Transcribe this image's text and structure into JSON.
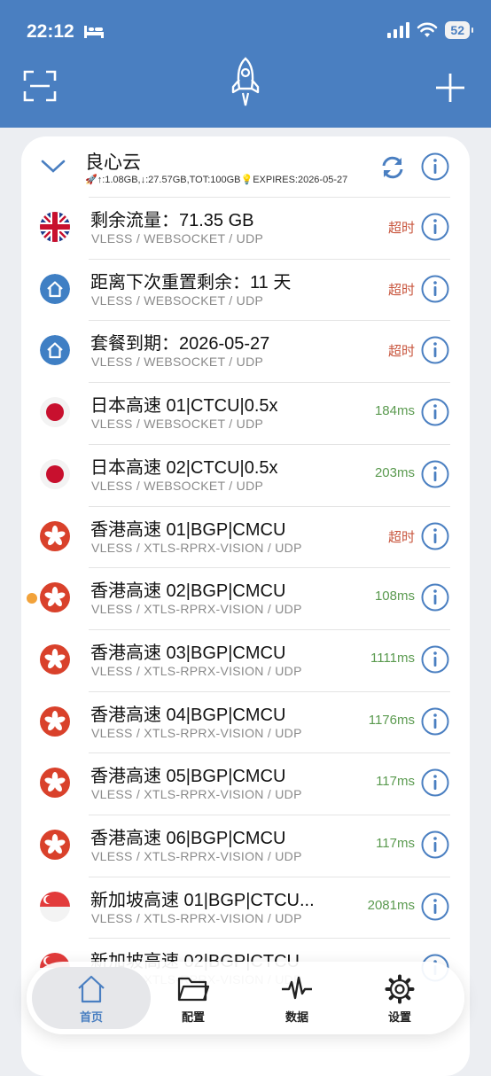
{
  "status": {
    "time": "22:12",
    "battery": "52"
  },
  "colors": {
    "header": "#4a7fc1",
    "latency_ok": "#5a9a4f",
    "latency_timeout": "#c8553d",
    "selected_dot": "#f2a23a"
  },
  "group": {
    "name": "良心云",
    "info": "🚀↑:1.08GB,↓:27.57GB,TOT:100GB💡EXPIRES:2026-05-27"
  },
  "servers": [
    {
      "flag": "uk",
      "name": "剩余流量：71.35 GB",
      "protocol": "VLESS / WEBSOCKET / UDP",
      "latency": "超时",
      "timeout": true
    },
    {
      "flag": "home",
      "name": "距离下次重置剩余：11 天",
      "protocol": "VLESS / WEBSOCKET / UDP",
      "latency": "超时",
      "timeout": true
    },
    {
      "flag": "home",
      "name": "套餐到期：2026-05-27",
      "protocol": "VLESS / WEBSOCKET / UDP",
      "latency": "超时",
      "timeout": true
    },
    {
      "flag": "jp",
      "name": "日本高速 01|CTCU|0.5x",
      "protocol": "VLESS / WEBSOCKET / UDP",
      "latency": "184ms",
      "timeout": false
    },
    {
      "flag": "jp",
      "name": "日本高速 02|CTCU|0.5x",
      "protocol": "VLESS / WEBSOCKET / UDP",
      "latency": "203ms",
      "timeout": false
    },
    {
      "flag": "hk",
      "name": "香港高速 01|BGP|CMCU",
      "protocol": "VLESS / XTLS-RPRX-VISION / UDP",
      "latency": "超时",
      "timeout": true
    },
    {
      "flag": "hk",
      "name": "香港高速 02|BGP|CMCU",
      "protocol": "VLESS / XTLS-RPRX-VISION / UDP",
      "latency": "108ms",
      "timeout": false,
      "selected": true
    },
    {
      "flag": "hk",
      "name": "香港高速 03|BGP|CMCU",
      "protocol": "VLESS / XTLS-RPRX-VISION / UDP",
      "latency": "1111ms",
      "timeout": false
    },
    {
      "flag": "hk",
      "name": "香港高速 04|BGP|CMCU",
      "protocol": "VLESS / XTLS-RPRX-VISION / UDP",
      "latency": "1176ms",
      "timeout": false
    },
    {
      "flag": "hk",
      "name": "香港高速 05|BGP|CMCU",
      "protocol": "VLESS / XTLS-RPRX-VISION / UDP",
      "latency": "117ms",
      "timeout": false
    },
    {
      "flag": "hk",
      "name": "香港高速 06|BGP|CMCU",
      "protocol": "VLESS / XTLS-RPRX-VISION / UDP",
      "latency": "117ms",
      "timeout": false
    },
    {
      "flag": "sg",
      "name": "新加坡高速 01|BGP|CTCU...",
      "protocol": "VLESS / XTLS-RPRX-VISION / UDP",
      "latency": "2081ms",
      "timeout": false
    },
    {
      "flag": "sg",
      "name": "新加坡高速 02|BGP|CTCU",
      "protocol": "VLESS / XTLS-RPRX-VISION / UDP",
      "latency": "",
      "timeout": false
    }
  ],
  "tabs": [
    {
      "label": "首页",
      "icon": "home-icon",
      "active": true
    },
    {
      "label": "配置",
      "icon": "folder-icon",
      "active": false
    },
    {
      "label": "数据",
      "icon": "pulse-icon",
      "active": false
    },
    {
      "label": "设置",
      "icon": "gear-icon",
      "active": false
    }
  ]
}
